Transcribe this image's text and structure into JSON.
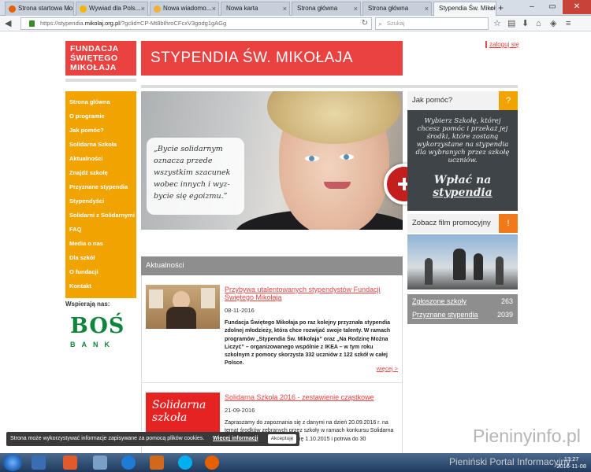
{
  "browser": {
    "tabs": [
      {
        "label": "Strona startowa Mozilla...",
        "icon": "firefox-icon",
        "color": "#e66000"
      },
      {
        "label": "Wywiad dla Pols...",
        "icon": "drive-icon",
        "color": "#f4b400"
      },
      {
        "label": "Nowa wiadomo...",
        "icon": "mail-icon",
        "color": "#f2b035"
      },
      {
        "label": "Nowa karta",
        "icon": "",
        "color": ""
      },
      {
        "label": "Strona główna",
        "icon": "",
        "color": ""
      },
      {
        "label": "Strona główna",
        "icon": "",
        "color": ""
      },
      {
        "label": "Stypendia Św. Mikoł...",
        "icon": "site-icon",
        "color": "#e94241"
      }
    ],
    "url_prefix": "https://stypendia.",
    "url_domain": "mikolaj.org.pl",
    "url_rest": "/?gclid=CP-Mt8bIhroCFcxV3godg1gAGg",
    "search_placeholder": "Szukaj"
  },
  "site": {
    "logo_lines": [
      "FUNDACJA",
      "ŚWIĘTEGO",
      "MIKOŁAJA"
    ],
    "banner_title": "STYPENDIA ŚW. MIKOŁAJA",
    "login": "zaloguj się",
    "menu": [
      "Strona główna",
      "O programie",
      "Jak pomóc?",
      "Solidarna Szkoła",
      "Aktualności",
      "Znajdź szkołę",
      "Przyznane stypendia",
      "Stypendyści",
      "Solidarni z Solidarnymi",
      "FAQ",
      "Media o nas",
      "Dla szkół",
      "O fundacji",
      "Kontakt"
    ],
    "supports_label": "Wspierają nas:",
    "sponsor": {
      "word": "BOŚ",
      "sub": "BANK",
      "color": "#10843b"
    },
    "hero_quote": "„Bycie solidarnym oznacza przede wszystkim szacunek wobec innych i wyz-bycie się egoizmu.”",
    "help": {
      "title": "Jak pomóc?",
      "badge": "?",
      "chalk_text": "Wybierz Szkołę, której chcesz pomóc i przekaż jej środki, które zostaną wykorzystane na stypendia dla wybranych przez szkołę uczniów.",
      "pay_line1": "Wpłać na",
      "pay_line2": "stypendia"
    },
    "video": {
      "title": "Zobacz film promocyjny",
      "badge": "!"
    },
    "stats": [
      {
        "label": "Zgłoszone szkoły",
        "value": "263"
      },
      {
        "label": "Przyznane stypendia",
        "value": "2039"
      }
    ],
    "news_header": "Aktualności",
    "news": [
      {
        "title": "Przybywa utalentowanych stypendystów Fundacji Świętego Mikołaja",
        "date": "08-11-2016",
        "body": "Fundacja Świętego Mikołaja po raz kolejny przyznała stypendia zdolnej młodzieży, która chce rozwijać swoje talenty. W ramach programów „Stypendia Św. Mikołaja” oraz „Na Rodzinę Można Liczyć” – organizowanego wspólnie z IKEA – w tym roku szkolnym z pomocy skorzysta 332 uczniów z 122 szkół w całej Polsce.",
        "more": "więcej >"
      },
      {
        "title": "Solidarna Szkoła 2016 - zestawienie cząstkowe",
        "date": "21-09-2016",
        "image_text": "Solidarna szkoła",
        "body": "Zapraszamy do zapoznania się z danymi na dzień 20.09.2016 r. na temat środków zebranych przez szkoły w ramach konkursu Solidarna Szkoła 2016, który rozpoczął się 1.10.2015 i potrwa do 30"
      }
    ],
    "cookie": {
      "text": "Strona może wykorzystywać informacje zapisywane za pomocą plików cookies.",
      "more": "Więcej informacji",
      "accept": "Akceptuję"
    }
  },
  "watermark": {
    "big": "Pieninyinfo.pl",
    "small": "Pieniński Portal Informacyjny"
  },
  "taskbar": {
    "time": "13:27",
    "date": "2016-11-08"
  },
  "colors": {
    "brand_red": "#e94241",
    "menu_orange": "#f1a400",
    "grey_panel": "#8e8e8e"
  }
}
